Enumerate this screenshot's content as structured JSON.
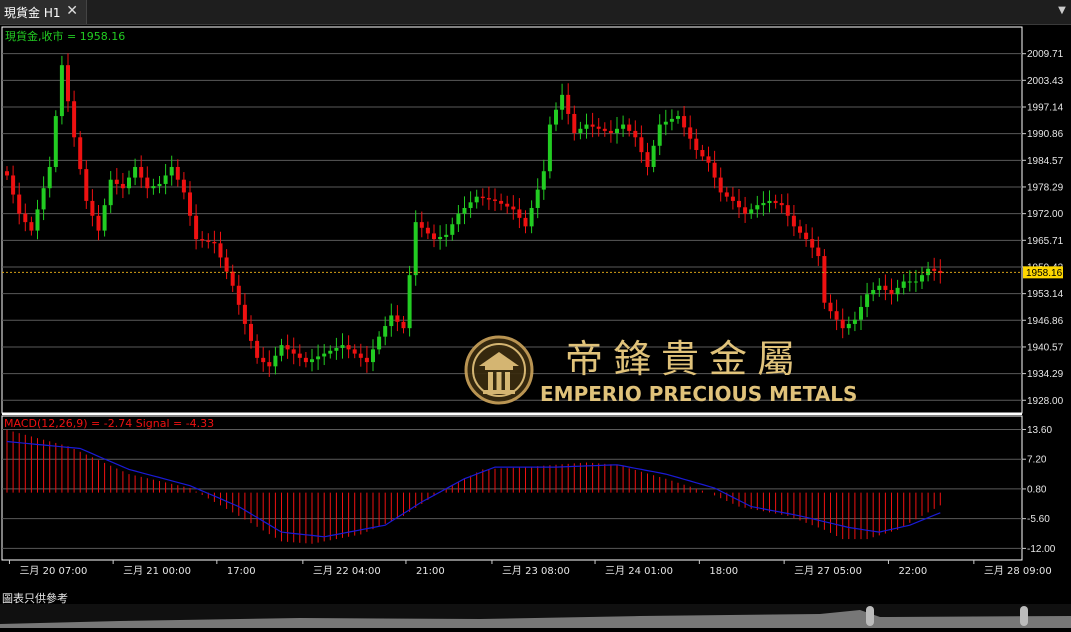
{
  "window": {
    "tab_title": "現貨金 H1"
  },
  "legend": {
    "price_label": "現貨金,收市 = 1958.16"
  },
  "footer": {
    "note": "圖表只供參考"
  },
  "watermark": {
    "chinese": "帝鋒貴金屬",
    "english": "EMPERIO PRECIOUS METALS"
  },
  "colors": {
    "up": "#22cc22",
    "down": "#ee1111",
    "signal": "#1a1ad6",
    "current_price": "#ffd700"
  },
  "chart_data": [
    {
      "type": "candlestick",
      "title": "現貨金 H1",
      "series_label": "現貨金,收市",
      "current_value": 1958.16,
      "current_label": "1958.16",
      "ylim": [
        1925.0,
        2016.0
      ],
      "yticks": [
        2009.71,
        2003.43,
        1997.14,
        1990.86,
        1984.57,
        1978.29,
        1972.0,
        1965.71,
        1959.43,
        1953.14,
        1946.86,
        1940.57,
        1934.29,
        1928.0
      ],
      "xticks": [
        "三月 20 07:00",
        "三月 21 00:00",
        "17:00",
        "三月 22 04:00",
        "21:00",
        "三月 23 08:00",
        "三月 24 01:00",
        "18:00",
        "三月 27 05:00",
        "22:00",
        "三月 28 09:00"
      ],
      "xtick_positions": [
        0.4,
        17.4,
        34.4,
        48.5,
        65.4,
        79.5,
        96.4,
        113.5,
        127.4,
        144.5,
        158.5
      ],
      "waypoints": [
        [
          0,
          1981
        ],
        [
          2,
          1972
        ],
        [
          4,
          1968
        ],
        [
          7,
          1983
        ],
        [
          9,
          2007
        ],
        [
          11,
          1990
        ],
        [
          13,
          1975
        ],
        [
          15,
          1968
        ],
        [
          17,
          1980
        ],
        [
          19,
          1978
        ],
        [
          21,
          1983
        ],
        [
          23,
          1978
        ],
        [
          25,
          1979
        ],
        [
          27,
          1983
        ],
        [
          29,
          1977
        ],
        [
          31,
          1966
        ],
        [
          34,
          1965
        ],
        [
          37,
          1955
        ],
        [
          39,
          1946
        ],
        [
          41,
          1938
        ],
        [
          43,
          1936
        ],
        [
          45,
          1941
        ],
        [
          49,
          1937
        ],
        [
          52,
          1939
        ],
        [
          55,
          1941
        ],
        [
          59,
          1937
        ],
        [
          61,
          1943
        ],
        [
          63,
          1948
        ],
        [
          65,
          1945
        ],
        [
          67,
          1970
        ],
        [
          70,
          1966
        ],
        [
          72,
          1967
        ],
        [
          74,
          1972
        ],
        [
          77,
          1976
        ],
        [
          80,
          1975
        ],
        [
          83,
          1973
        ],
        [
          85,
          1969
        ],
        [
          88,
          1982
        ],
        [
          89,
          1993
        ],
        [
          91,
          2000
        ],
        [
          93,
          1991
        ],
        [
          95,
          1993
        ],
        [
          97,
          1992
        ],
        [
          99,
          1991
        ],
        [
          101,
          1993
        ],
        [
          103,
          1990
        ],
        [
          105,
          1983
        ],
        [
          107,
          1993
        ],
        [
          110,
          1995
        ],
        [
          113,
          1987
        ],
        [
          115,
          1984
        ],
        [
          117,
          1977
        ],
        [
          119,
          1975
        ],
        [
          121,
          1972
        ],
        [
          123,
          1974
        ],
        [
          125,
          1975
        ],
        [
          127,
          1974
        ],
        [
          129,
          1969
        ],
        [
          131,
          1966
        ],
        [
          133,
          1962
        ],
        [
          134,
          1951
        ],
        [
          136,
          1947
        ],
        [
          137,
          1945
        ],
        [
          139,
          1947
        ],
        [
          141,
          1953
        ],
        [
          143,
          1955
        ],
        [
          145,
          1953
        ],
        [
          147,
          1956
        ],
        [
          149,
          1956
        ],
        [
          151,
          1959
        ],
        [
          153,
          1958
        ]
      ]
    },
    {
      "type": "macd",
      "label": "MACD(12,26,9) = -2.74 Signal = -4.33",
      "macd_value": -2.74,
      "signal_value": -4.33,
      "ylim": [
        -14.5,
        16.5
      ],
      "yticks": [
        13.6,
        7.2,
        0.8,
        -5.6,
        -12.0
      ],
      "macd_waypoints": [
        [
          0,
          13.5
        ],
        [
          10,
          10
        ],
        [
          20,
          4
        ],
        [
          30,
          1
        ],
        [
          38,
          -5
        ],
        [
          45,
          -10.5
        ],
        [
          50,
          -11
        ],
        [
          58,
          -9
        ],
        [
          65,
          -5
        ],
        [
          72,
          1
        ],
        [
          78,
          5
        ],
        [
          85,
          5.5
        ],
        [
          95,
          6.5
        ],
        [
          100,
          6
        ],
        [
          108,
          3
        ],
        [
          115,
          0
        ],
        [
          120,
          -3
        ],
        [
          128,
          -5
        ],
        [
          134,
          -8
        ],
        [
          137,
          -10
        ],
        [
          141,
          -10
        ],
        [
          146,
          -8
        ],
        [
          153,
          -2.74
        ]
      ],
      "signal_waypoints": [
        [
          0,
          11
        ],
        [
          12,
          9.5
        ],
        [
          20,
          5
        ],
        [
          30,
          1.5
        ],
        [
          38,
          -3
        ],
        [
          45,
          -8.5
        ],
        [
          52,
          -9.5
        ],
        [
          62,
          -7
        ],
        [
          68,
          -2
        ],
        [
          75,
          3
        ],
        [
          80,
          5.5
        ],
        [
          90,
          5.5
        ],
        [
          100,
          6
        ],
        [
          108,
          4
        ],
        [
          116,
          1
        ],
        [
          122,
          -3
        ],
        [
          130,
          -5
        ],
        [
          138,
          -7.5
        ],
        [
          143,
          -8.5
        ],
        [
          148,
          -7
        ],
        [
          153,
          -4.33
        ]
      ]
    }
  ]
}
